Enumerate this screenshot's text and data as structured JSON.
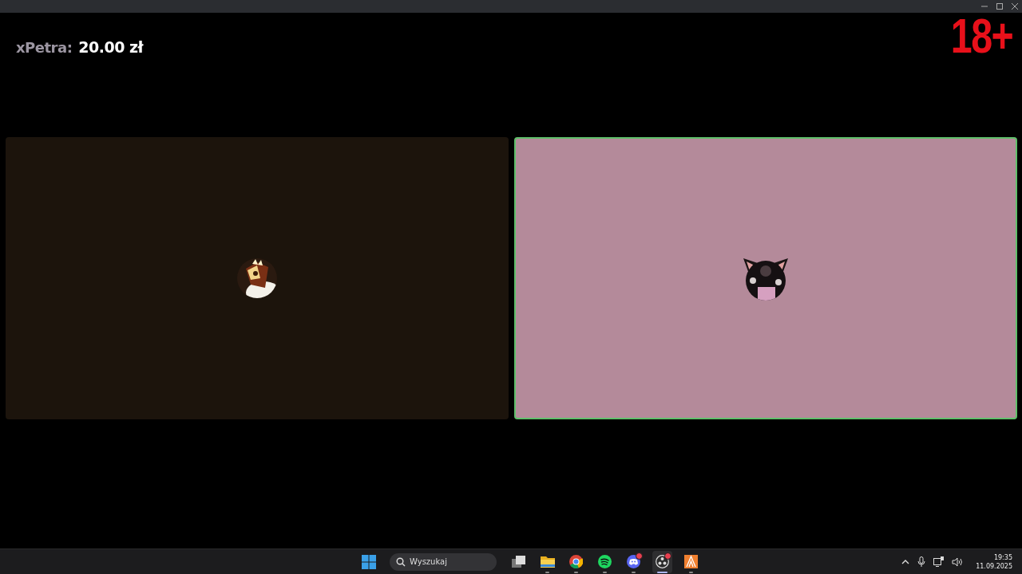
{
  "overlay": {
    "name": "xPetra:",
    "amount": "20.00 zł"
  },
  "rating": "18+",
  "tiles": [
    {
      "speaking": false,
      "color": "#1c140c"
    },
    {
      "speaking": true,
      "color": "#b48a9a"
    }
  ],
  "taskbar": {
    "search": {
      "placeholder": "Wyszukaj"
    },
    "apps": [
      {
        "kind": "task-view",
        "running": false,
        "selected": false,
        "badge": false
      },
      {
        "kind": "folder",
        "running": true,
        "selected": false,
        "badge": false
      },
      {
        "kind": "browser",
        "running": true,
        "selected": false,
        "badge": false
      },
      {
        "kind": "music",
        "running": true,
        "selected": false,
        "badge": false
      },
      {
        "kind": "chat",
        "running": true,
        "selected": false,
        "badge": true
      },
      {
        "kind": "recorder",
        "running": true,
        "selected": true,
        "badge": true
      },
      {
        "kind": "orange",
        "running": true,
        "selected": false,
        "badge": false
      }
    ],
    "clock": {
      "time": "19:35",
      "date": "11.09.2025"
    }
  }
}
